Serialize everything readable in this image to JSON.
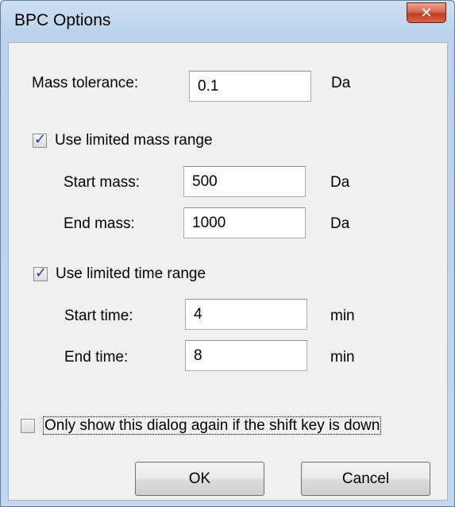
{
  "window": {
    "title": "BPC Options",
    "close_glyph": "✕"
  },
  "mass_tolerance": {
    "label": "Mass tolerance:",
    "value": "0.1",
    "unit": "Da"
  },
  "mass_range": {
    "checkbox_label": "Use limited mass range",
    "checked": true,
    "start": {
      "label": "Start mass:",
      "value": "500",
      "unit": "Da"
    },
    "end": {
      "label": "End mass:",
      "value": "1000",
      "unit": "Da"
    }
  },
  "time_range": {
    "checkbox_label": "Use limited time range",
    "checked": true,
    "start": {
      "label": "Start time:",
      "value": "4",
      "unit": "min"
    },
    "end": {
      "label": "End time:",
      "value": "8",
      "unit": "min"
    }
  },
  "shift_option": {
    "label": "Only show this dialog again if the shift key is down",
    "checked": false
  },
  "buttons": {
    "ok": "OK",
    "cancel": "Cancel"
  },
  "check_glyph": "✓",
  "colors": {
    "close_button": "#c94a30",
    "check_mark": "#1e3f8a"
  }
}
